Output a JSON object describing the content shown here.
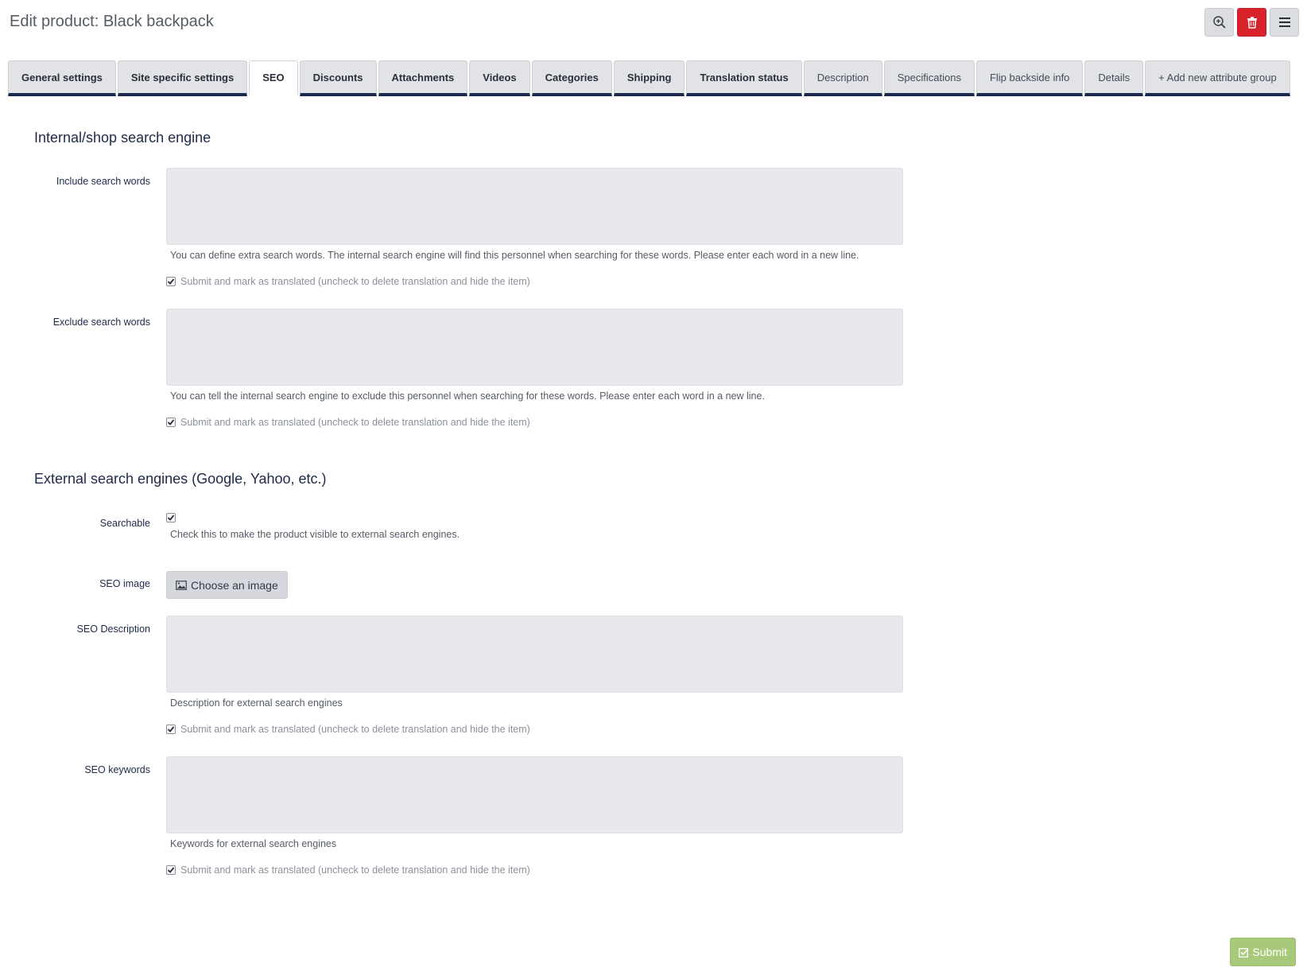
{
  "page": {
    "title": "Edit product: Black backpack"
  },
  "actions": [
    {
      "name": "zoom-button",
      "icon": "magnifier-plus-icon"
    },
    {
      "name": "delete-button",
      "icon": "trash-icon"
    },
    {
      "name": "menu-button",
      "icon": "hamburger-icon"
    }
  ],
  "tabs": [
    {
      "label": "General settings"
    },
    {
      "label": "Site specific settings"
    },
    {
      "label": "SEO",
      "active": true
    },
    {
      "label": "Discounts"
    },
    {
      "label": "Attachments"
    },
    {
      "label": "Videos"
    },
    {
      "label": "Categories"
    },
    {
      "label": "Shipping"
    },
    {
      "label": "Translation status"
    },
    {
      "label": "Description"
    },
    {
      "label": "Specifications"
    },
    {
      "label": "Flip backside info"
    },
    {
      "label": "Details"
    },
    {
      "label": "+ Add new attribute group"
    }
  ],
  "internal": {
    "title": "Internal/shop search engine",
    "include_label": "Include search words",
    "include_value": "",
    "include_help": "You can define extra search words. The internal search engine will find this personnel when searching for these words. Please enter each word in a new line.",
    "include_translated": "Submit and mark as translated (uncheck to delete translation and hide the item)",
    "exclude_label": "Exclude search words",
    "exclude_value": "",
    "exclude_help": "You can tell the internal search engine to exclude this personnel when searching for these words. Please enter each word in a new line.",
    "exclude_translated": "Submit and mark as translated (uncheck to delete translation and hide the item)"
  },
  "external": {
    "title": "External search engines (Google, Yahoo, etc.)",
    "searchable_label": "Searchable",
    "searchable_checked": true,
    "searchable_help": "Check this to make the product visible to external search engines.",
    "seo_image_label": "SEO image",
    "seo_image_button": "Choose an image",
    "seo_description_label": "SEO Description",
    "seo_description_value": "",
    "seo_description_help": "Description for external search engines",
    "seo_description_translated": "Submit and mark as translated (uncheck to delete translation and hide the item)",
    "seo_keywords_label": "SEO keywords",
    "seo_keywords_value": "",
    "seo_keywords_help": "Keywords for external search engines",
    "seo_keywords_translated": "Submit and mark as translated (uncheck to delete translation and hide the item)"
  },
  "submit": {
    "label": "Submit"
  },
  "colors": {
    "accent": "#1b2950",
    "danger": "#d9232c",
    "success": "#a9c97a"
  }
}
